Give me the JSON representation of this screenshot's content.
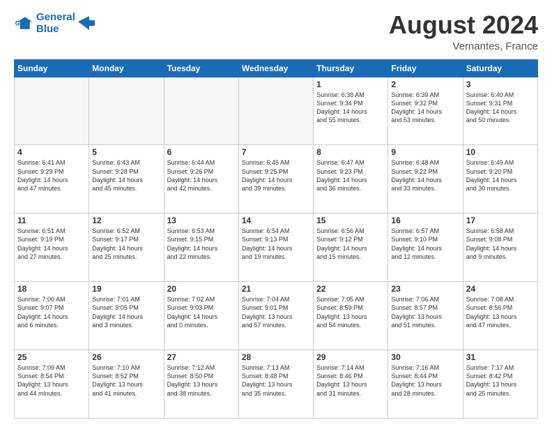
{
  "logo": {
    "line1": "General",
    "line2": "Blue"
  },
  "title": "August 2024",
  "subtitle": "Vernantes, France",
  "days_header": [
    "Sunday",
    "Monday",
    "Tuesday",
    "Wednesday",
    "Thursday",
    "Friday",
    "Saturday"
  ],
  "weeks": [
    [
      {
        "day": "",
        "detail": ""
      },
      {
        "day": "",
        "detail": ""
      },
      {
        "day": "",
        "detail": ""
      },
      {
        "day": "",
        "detail": ""
      },
      {
        "day": "1",
        "detail": "Sunrise: 6:38 AM\nSunset: 9:34 PM\nDaylight: 14 hours\nand 55 minutes."
      },
      {
        "day": "2",
        "detail": "Sunrise: 6:39 AM\nSunset: 9:32 PM\nDaylight: 14 hours\nand 53 minutes."
      },
      {
        "day": "3",
        "detail": "Sunrise: 6:40 AM\nSunset: 9:31 PM\nDaylight: 14 hours\nand 50 minutes."
      }
    ],
    [
      {
        "day": "4",
        "detail": "Sunrise: 6:41 AM\nSunset: 9:29 PM\nDaylight: 14 hours\nand 47 minutes."
      },
      {
        "day": "5",
        "detail": "Sunrise: 6:43 AM\nSunset: 9:28 PM\nDaylight: 14 hours\nand 45 minutes."
      },
      {
        "day": "6",
        "detail": "Sunrise: 6:44 AM\nSunset: 9:26 PM\nDaylight: 14 hours\nand 42 minutes."
      },
      {
        "day": "7",
        "detail": "Sunrise: 6:45 AM\nSunset: 9:25 PM\nDaylight: 14 hours\nand 39 minutes."
      },
      {
        "day": "8",
        "detail": "Sunrise: 6:47 AM\nSunset: 9:23 PM\nDaylight: 14 hours\nand 36 minutes."
      },
      {
        "day": "9",
        "detail": "Sunrise: 6:48 AM\nSunset: 9:22 PM\nDaylight: 14 hours\nand 33 minutes."
      },
      {
        "day": "10",
        "detail": "Sunrise: 6:49 AM\nSunset: 9:20 PM\nDaylight: 14 hours\nand 30 minutes."
      }
    ],
    [
      {
        "day": "11",
        "detail": "Sunrise: 6:51 AM\nSunset: 9:19 PM\nDaylight: 14 hours\nand 27 minutes."
      },
      {
        "day": "12",
        "detail": "Sunrise: 6:52 AM\nSunset: 9:17 PM\nDaylight: 14 hours\nand 25 minutes."
      },
      {
        "day": "13",
        "detail": "Sunrise: 6:53 AM\nSunset: 9:15 PM\nDaylight: 14 hours\nand 22 minutes."
      },
      {
        "day": "14",
        "detail": "Sunrise: 6:54 AM\nSunset: 9:13 PM\nDaylight: 14 hours\nand 19 minutes."
      },
      {
        "day": "15",
        "detail": "Sunrise: 6:56 AM\nSunset: 9:12 PM\nDaylight: 14 hours\nand 15 minutes."
      },
      {
        "day": "16",
        "detail": "Sunrise: 6:57 AM\nSunset: 9:10 PM\nDaylight: 14 hours\nand 12 minutes."
      },
      {
        "day": "17",
        "detail": "Sunrise: 6:58 AM\nSunset: 9:08 PM\nDaylight: 14 hours\nand 9 minutes."
      }
    ],
    [
      {
        "day": "18",
        "detail": "Sunrise: 7:00 AM\nSunset: 9:07 PM\nDaylight: 14 hours\nand 6 minutes."
      },
      {
        "day": "19",
        "detail": "Sunrise: 7:01 AM\nSunset: 9:05 PM\nDaylight: 14 hours\nand 3 minutes."
      },
      {
        "day": "20",
        "detail": "Sunrise: 7:02 AM\nSunset: 9:03 PM\nDaylight: 14 hours\nand 0 minutes."
      },
      {
        "day": "21",
        "detail": "Sunrise: 7:04 AM\nSunset: 9:01 PM\nDaylight: 13 hours\nand 57 minutes."
      },
      {
        "day": "22",
        "detail": "Sunrise: 7:05 AM\nSunset: 8:59 PM\nDaylight: 13 hours\nand 54 minutes."
      },
      {
        "day": "23",
        "detail": "Sunrise: 7:06 AM\nSunset: 8:57 PM\nDaylight: 13 hours\nand 51 minutes."
      },
      {
        "day": "24",
        "detail": "Sunrise: 7:08 AM\nSunset: 8:56 PM\nDaylight: 13 hours\nand 47 minutes."
      }
    ],
    [
      {
        "day": "25",
        "detail": "Sunrise: 7:09 AM\nSunset: 8:54 PM\nDaylight: 13 hours\nand 44 minutes."
      },
      {
        "day": "26",
        "detail": "Sunrise: 7:10 AM\nSunset: 8:52 PM\nDaylight: 13 hours\nand 41 minutes."
      },
      {
        "day": "27",
        "detail": "Sunrise: 7:12 AM\nSunset: 8:50 PM\nDaylight: 13 hours\nand 38 minutes."
      },
      {
        "day": "28",
        "detail": "Sunrise: 7:13 AM\nSunset: 8:48 PM\nDaylight: 13 hours\nand 35 minutes."
      },
      {
        "day": "29",
        "detail": "Sunrise: 7:14 AM\nSunset: 8:46 PM\nDaylight: 13 hours\nand 31 minutes."
      },
      {
        "day": "30",
        "detail": "Sunrise: 7:16 AM\nSunset: 8:44 PM\nDaylight: 13 hours\nand 28 minutes."
      },
      {
        "day": "31",
        "detail": "Sunrise: 7:17 AM\nSunset: 8:42 PM\nDaylight: 13 hours\nand 25 minutes."
      }
    ]
  ]
}
